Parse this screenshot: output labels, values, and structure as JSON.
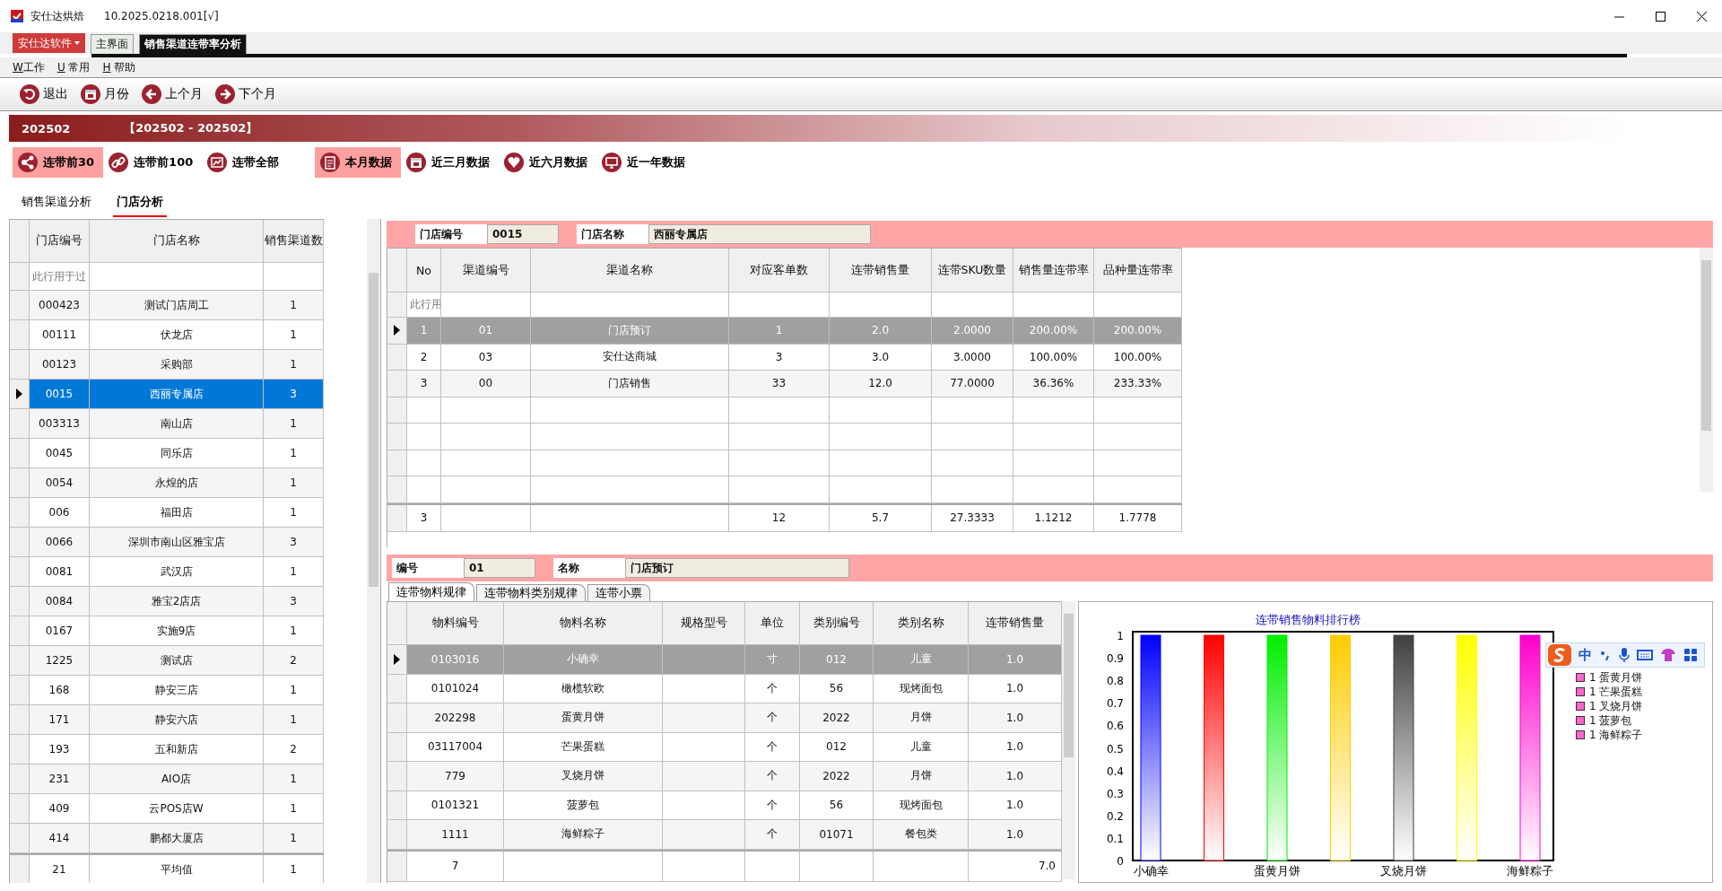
{
  "window": {
    "title": "安仕达烘焙",
    "version": "10.2025.0218.001[√]"
  },
  "app_menu_button": "安仕达软件",
  "doc_tabs": [
    {
      "label": "主界面",
      "selected": false
    },
    {
      "label": "销售渠道连带率分析",
      "selected": true
    }
  ],
  "menu": [
    "W工作",
    "U 常用",
    "H 帮助"
  ],
  "toolbar": [
    {
      "kind": "exit",
      "label": "退出"
    },
    {
      "kind": "calendar",
      "label": "月份"
    },
    {
      "kind": "prev",
      "label": "上个月"
    },
    {
      "kind": "next",
      "label": "下个月"
    }
  ],
  "period_bar": {
    "month": "202502",
    "range": "【202502 - 202502】"
  },
  "link_filters": [
    {
      "kind": "nodes",
      "label": "连带前30",
      "selected": true
    },
    {
      "kind": "link",
      "label": "连带前100",
      "selected": false
    },
    {
      "kind": "chart",
      "label": "连带全部",
      "selected": false
    }
  ],
  "period_filters": [
    {
      "kind": "clipboard",
      "label": "本月数据",
      "selected": true
    },
    {
      "kind": "calendar",
      "label": "近三月数据",
      "selected": false
    },
    {
      "kind": "heart",
      "label": "近六月数据",
      "selected": false
    },
    {
      "kind": "monitor",
      "label": "近一年数据",
      "selected": false
    }
  ],
  "view_tabs": [
    {
      "label": "销售渠道分析",
      "selected": false
    },
    {
      "label": "门店分析",
      "selected": true
    }
  ],
  "store_table": {
    "columns": [
      "门店编号",
      "门店名称",
      "销售渠道数"
    ],
    "filter_hint": "此行用于过",
    "rows": [
      {
        "cells": [
          "000423",
          "测试门店周工",
          "1"
        ],
        "selected": false
      },
      {
        "cells": [
          "00111",
          "伏龙店",
          "1"
        ],
        "selected": false
      },
      {
        "cells": [
          "00123",
          "采购部",
          "1"
        ],
        "selected": false
      },
      {
        "cells": [
          "0015",
          "西丽专属店",
          "3"
        ],
        "selected": true
      },
      {
        "cells": [
          "003313",
          "南山店",
          "1"
        ],
        "selected": false
      },
      {
        "cells": [
          "0045",
          "同乐店",
          "1"
        ],
        "selected": false
      },
      {
        "cells": [
          "0054",
          "永煌的店",
          "1"
        ],
        "selected": false
      },
      {
        "cells": [
          "006",
          "福田店",
          "1"
        ],
        "selected": false
      },
      {
        "cells": [
          "0066",
          "深圳市南山区雅宝店",
          "3"
        ],
        "selected": false
      },
      {
        "cells": [
          "0081",
          "武汉店",
          "1"
        ],
        "selected": false
      },
      {
        "cells": [
          "0084",
          "雅宝2店店",
          "3"
        ],
        "selected": false
      },
      {
        "cells": [
          "0167",
          "实施9店",
          "1"
        ],
        "selected": false
      },
      {
        "cells": [
          "1225",
          "测试店",
          "2"
        ],
        "selected": false
      },
      {
        "cells": [
          "168",
          "静安三店",
          "1"
        ],
        "selected": false
      },
      {
        "cells": [
          "171",
          "静安六店",
          "1"
        ],
        "selected": false
      },
      {
        "cells": [
          "193",
          "五和新店",
          "2"
        ],
        "selected": false
      },
      {
        "cells": [
          "231",
          "AIO店",
          "1"
        ],
        "selected": false
      },
      {
        "cells": [
          "409",
          "云POS店W",
          "1"
        ],
        "selected": false
      },
      {
        "cells": [
          "414",
          "鹏都大厦店",
          "1"
        ],
        "selected": false
      }
    ],
    "footer": [
      "21",
      "平均值",
      "1"
    ]
  },
  "channel_panel": {
    "fields": [
      {
        "label": "门店编号",
        "value": "0015"
      },
      {
        "label": "门店名称",
        "value": "西丽专属店"
      }
    ],
    "columns": [
      "No",
      "渠道编号",
      "渠道名称",
      "对应客单数",
      "连带销售量",
      "连带SKU数量",
      "销售量连带率",
      "品种量连带率"
    ],
    "filter_hint": "此行用",
    "rows": [
      {
        "cells": [
          "1",
          "01",
          "门店预订",
          "1",
          "2.0",
          "2.0000",
          "200.00%",
          "200.00%"
        ],
        "selected": true
      },
      {
        "cells": [
          "2",
          "03",
          "安仕达商城",
          "3",
          "3.0",
          "3.0000",
          "100.00%",
          "100.00%"
        ],
        "selected": false
      },
      {
        "cells": [
          "3",
          "00",
          "门店销售",
          "33",
          "12.0",
          "77.0000",
          "36.36%",
          "233.33%"
        ],
        "selected": false
      }
    ],
    "footer": {
      "count": "3",
      "orders": "12",
      "qty": "5.7",
      "sku": "27.3333",
      "qty_rate": "1.1212",
      "variety_rate": "1.7778"
    }
  },
  "item_panel": {
    "fields": [
      {
        "label": "编号",
        "value": "01"
      },
      {
        "label": "名称",
        "value": "门店预订"
      }
    ],
    "tabs": [
      {
        "label": "连带物料规律",
        "selected": true
      },
      {
        "label": "连带物料类别规律",
        "selected": false
      },
      {
        "label": "连带小票",
        "selected": false
      }
    ],
    "columns": [
      "物料编号",
      "物料名称",
      "规格型号",
      "单位",
      "类别编号",
      "类别名称",
      "连带销售量"
    ],
    "rows": [
      {
        "code": "0103016",
        "name": "小确幸",
        "unit": "寸",
        "category_code": "012",
        "category_name": "儿童",
        "qty": "1.0",
        "selected": true
      },
      {
        "code": "0101024",
        "name": "橄榄软欧",
        "unit": "个",
        "category_code": "56",
        "category_name": "现烤面包",
        "qty": "1.0",
        "selected": false
      },
      {
        "code": "202298",
        "name": "蛋黄月饼",
        "unit": "个",
        "category_code": "2022",
        "category_name": "月饼",
        "qty": "1.0",
        "selected": false
      },
      {
        "code": "03117004",
        "name": "芒果蛋糕",
        "unit": "个",
        "category_code": "012",
        "category_name": "儿童",
        "qty": "1.0",
        "selected": false
      },
      {
        "code": "779",
        "name": "叉烧月饼",
        "unit": "个",
        "category_code": "2022",
        "category_name": "月饼",
        "qty": "1.0",
        "selected": false
      },
      {
        "code": "0101321",
        "name": "菠萝包",
        "unit": "个",
        "category_code": "56",
        "category_name": "现烤面包",
        "qty": "1.0",
        "selected": false
      },
      {
        "code": "1111",
        "name": "海鲜粽子",
        "unit": "个",
        "category_code": "01071",
        "category_name": "餐包类",
        "qty": "1.0",
        "selected": false
      }
    ],
    "footer": {
      "count": "7",
      "qty": "7.0"
    },
    "chart_data": {
      "type": "bar",
      "title": "连带销售物料排行榜",
      "categories": [
        "小确幸",
        null,
        "蛋黄月饼",
        null,
        "叉烧月饼",
        null,
        "海鲜粽子"
      ],
      "values": [
        1,
        1,
        1,
        1,
        1,
        1,
        1
      ],
      "colors": [
        "#0000ff",
        "#ff0000",
        "#00ee00",
        "#ffcc00",
        "#404040",
        "#ffff00",
        "#ff00cc"
      ],
      "ylim": [
        0,
        1
      ],
      "yticks": [
        0,
        0.1,
        0.2,
        0.3,
        0.4,
        0.5,
        0.6,
        0.7,
        0.8,
        0.9,
        1
      ]
    },
    "legend": [
      "1 蛋黄月饼",
      "1 芒果蛋糕",
      "1 叉烧月饼",
      "1 菠萝包",
      "1 海鲜粽子"
    ]
  },
  "ime_toolbar": {
    "label": "中"
  }
}
